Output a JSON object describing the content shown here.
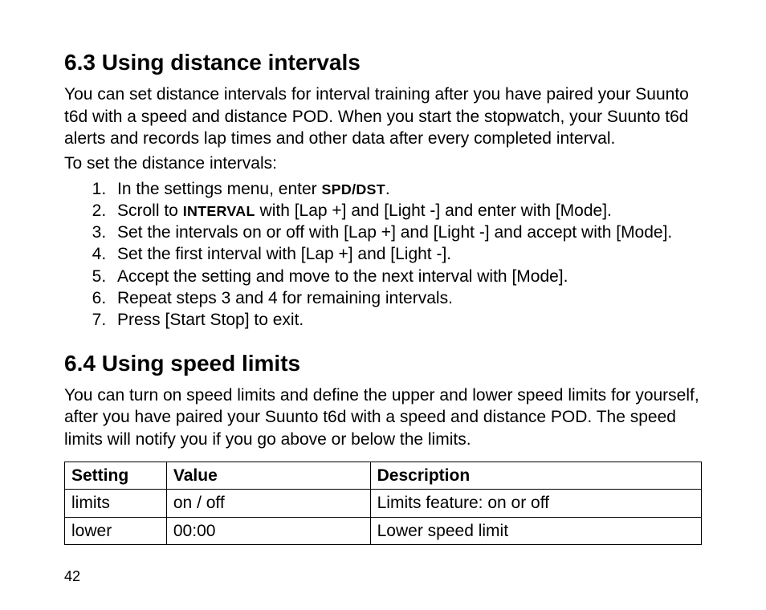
{
  "section_63": {
    "heading": "6.3  Using distance intervals",
    "para1": "You can set distance intervals for interval training after you have paired your Suunto t6d with a speed and distance POD. When you start the stopwatch, your Suunto t6d alerts and records lap times and other data after every completed interval.",
    "para2": "To set the distance intervals:",
    "steps": {
      "s1_a": "In the settings menu, enter ",
      "s1_b": "SPD/DST",
      "s1_c": ".",
      "s2_a": "Scroll to ",
      "s2_b": "INTERVAL",
      "s2_c": " with [Lap +] and [Light -] and enter with [Mode].",
      "s3": "Set the intervals on or off with [Lap +] and [Light -] and accept with [Mode].",
      "s4": "Set the first interval with [Lap +] and [Light -].",
      "s5": "Accept the setting and move to the next interval with [Mode].",
      "s6": "Repeat steps 3 and 4 for remaining intervals.",
      "s7": "Press [Start Stop] to exit."
    }
  },
  "section_64": {
    "heading": "6.4  Using speed limits",
    "para": "You can turn on speed limits and define the upper and lower speed limits for yourself, after you have paired your Suunto t6d with a speed and distance POD. The speed limits will notify you if you go above or below the limits.",
    "table": {
      "headers": {
        "setting": "Setting",
        "value": "Value",
        "desc": "Description"
      },
      "rows": [
        {
          "setting": "limits",
          "value": "on / off",
          "desc": "Limits feature: on or off"
        },
        {
          "setting": "lower",
          "value": "00:00",
          "desc": "Lower speed limit"
        }
      ]
    }
  },
  "page_number": "42"
}
